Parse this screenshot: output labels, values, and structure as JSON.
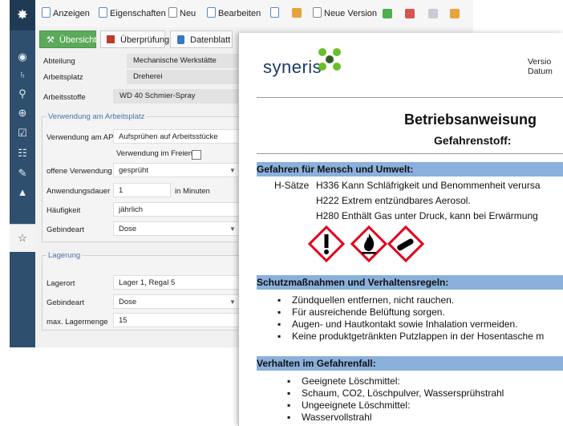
{
  "sidebar": {
    "items": [
      "palette-icon",
      "hierarchy-icon",
      "search-icon",
      "zoom-icon",
      "checklist-icon",
      "sitemap-icon",
      "pencil-icon",
      "graduation-cap-icon"
    ],
    "favorite_icon": "star-icon"
  },
  "toolbar": {
    "anzeigen": "Anzeigen",
    "eigenschaften": "Eigenschaften",
    "neu": "Neu",
    "bearbeiten": "Bearbeiten",
    "neue_version": "Neue Version"
  },
  "tabs": [
    "Übersicht",
    "Überprüfung",
    "Datenblatt"
  ],
  "top_fields": [
    {
      "label": "Abteilung",
      "value": "Mechanische Werkstätte"
    },
    {
      "label": "Arbeitsplatz",
      "value": "Dreherei"
    },
    {
      "label": "Arbeitsstoffe",
      "value": "WD 40 Schmier-Spray"
    }
  ],
  "verwendung": {
    "title": "Verwendung am Arbeitsplatz",
    "verwendung_am_ap_label": "Verwendung am AP",
    "verwendung_am_ap_value": "Aufsprühen auf Arbeitsstücke",
    "im_freien_label": "Verwendung im Freien",
    "offene_label": "offene Verwendung",
    "offene_value": "gesprüht",
    "dauer_label": "Anwendungsdauer",
    "dauer_value": "1",
    "dauer_unit": "in Minuten",
    "haeufigkeit_label": "Häufigkeit",
    "haeufigkeit_value": "jährlich",
    "gebinde_label": "Gebindeart",
    "gebinde_value": "Dose"
  },
  "lagerung": {
    "title": "Lagerung",
    "lagerort_label": "Lagerort",
    "lagerort_value": "Lager 1, Regal 5",
    "gebinde_label": "Gebindeart",
    "gebinde_value": "Dose",
    "menge_label": "max. Lagermenge",
    "menge_value": "15"
  },
  "document": {
    "logo_text": "syneris",
    "version_label": "Versio",
    "datum_label": "Datum",
    "title": "Betriebsanweisung",
    "subtitle": "Gefahrenstoff:",
    "section1_title": "Gefahren für Mensch und Umwelt:",
    "h_saetze_label": "H-Sätze",
    "h_lines": [
      "H336 Kann Schläfrigkeit und Benommenheit verursa",
      "H222 Extrem entzündbares Aerosol.",
      "H280 Enthält Gas unter Druck, kann bei Erwärmung"
    ],
    "pictograms": [
      "exclamation-mark-pictogram",
      "flame-pictogram",
      "gas-cylinder-pictogram"
    ],
    "section2_title": "Schutzmaßnahmen und Verhaltensregeln:",
    "section2_items": [
      "Zündquellen entfernen, nicht rauchen.",
      "Für ausreichende Belüftung sorgen.",
      "Augen- und Hautkontakt sowie Inhalation vermeiden.",
      "Keine produktgetränkten Putzlappen in der Hosentasche m"
    ],
    "section3_title": "Verhalten im Gefahrenfall:",
    "section3_items": [
      "Geeignete Löschmittel:",
      "Schaum, CO2, Löschpulver, Wassersprühstrahl",
      "Ungeeignete Löschmittel:",
      "Wasservollstrahl"
    ]
  },
  "colors": {
    "sidebar": "#2e4f6e",
    "active_tab": "#5aaa5a",
    "section_band": "#8ab0db",
    "section_header_text": "#4a74a8",
    "pictogram_border": "#e0001a"
  }
}
